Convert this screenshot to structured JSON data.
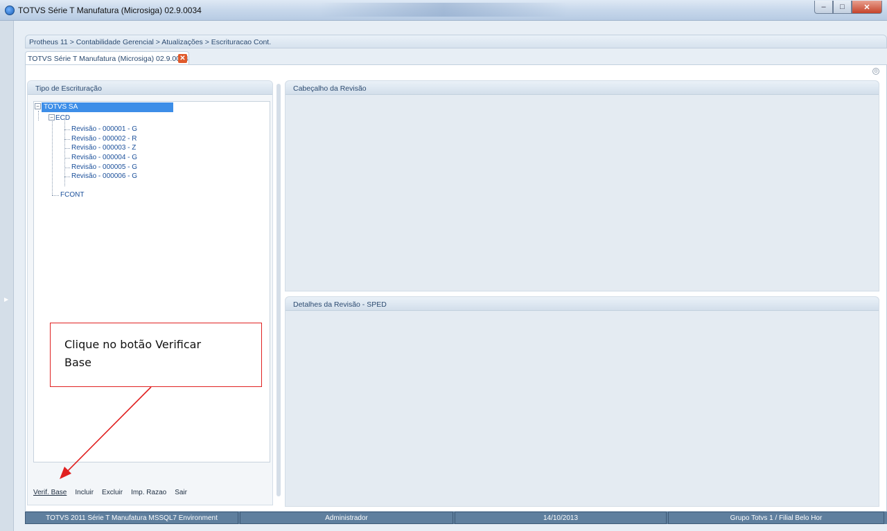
{
  "window": {
    "title": "TOTVS Série T Manufatura (Microsiga) 02.9.0034"
  },
  "breadcrumb": "Protheus 11 > Contabilidade Gerencial > Atualizações > Escrituracao Cont.",
  "tab": {
    "label": "TOTVS Série T Manufatura (Microsiga) 02.9.0034"
  },
  "left_panel": {
    "title": "Tipo de Escrituração",
    "tree": {
      "root": "TOTVS SA",
      "ecd": "ECD",
      "revisions": [
        "Revisão - 000001 - G",
        "Revisão - 000002 - R",
        "Revisão - 000003 - Z",
        "Revisão - 000004 - G",
        "Revisão - 000005 - G",
        "Revisão - 000006 - G"
      ],
      "fcont": "FCONT"
    },
    "buttons": {
      "verif_base": "Verif. Base",
      "incluir": "Incluir",
      "excluir": "Excluir",
      "imp_razao": "Imp. Razao",
      "sair": "Sair"
    }
  },
  "right_panels": {
    "header_title": "Cabeçalho da Revisão",
    "details_title": "Detalhes da Revisão - SPED"
  },
  "statusbar": {
    "environment": "TOTVS 2011 Série T Manufatura MSSQL7 Environment",
    "user": "Administrador",
    "date": "14/10/2013",
    "branch": "Grupo Totvs 1 / Filial Belo Hor"
  },
  "annotation": {
    "text": "Clique no botão Verificar Base"
  },
  "colors": {
    "accent": "#3d8ee8",
    "callout_border": "#e02020",
    "status_bg": "#5f7f9e"
  }
}
